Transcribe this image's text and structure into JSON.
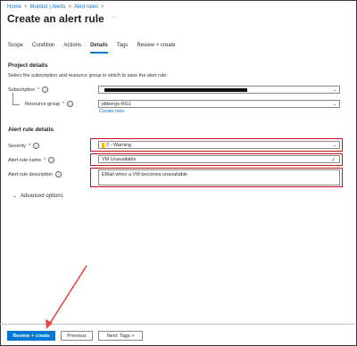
{
  "breadcrumb": {
    "items": [
      "Home",
      "Monitor | Alerts",
      "Alert rules"
    ],
    "separator": ">"
  },
  "page": {
    "title": "Create an alert rule",
    "more": "···"
  },
  "tabs": [
    "Scope",
    "Condition",
    "Actions",
    "Details",
    "Tags",
    "Review + create"
  ],
  "active_tab": "Details",
  "project_details": {
    "heading": "Project details",
    "description": "Select the subscription and resource group in which to save the alert rule.",
    "subscription_label": "Subscription",
    "resource_group_label": "Resource group",
    "resource_group_value": "pbbergs-RG1",
    "create_new": "Create new"
  },
  "alert_rule_details": {
    "heading": "Alert rule details",
    "severity_label": "Severity",
    "severity_value": "2 - Warning",
    "name_label": "Alert rule name",
    "name_value": "VM Unavailable",
    "description_label": "Alert rule description",
    "description_value": "EMail when a VM becomes unavailable"
  },
  "advanced": {
    "label": "Advanced options"
  },
  "footer": {
    "review_create": "Review + create",
    "previous": "Previous",
    "next": "Next: Tags >"
  },
  "colors": {
    "accent": "#0078d4",
    "highlight": "#c50f1f",
    "arrow": "#e04a3f",
    "warning": "#ffb900"
  },
  "icons": {
    "info": "info-icon",
    "chevron_down": "chevron-down-icon",
    "checkmark": "checkmark-icon",
    "chevron_expand": "chevron-down-icon"
  }
}
